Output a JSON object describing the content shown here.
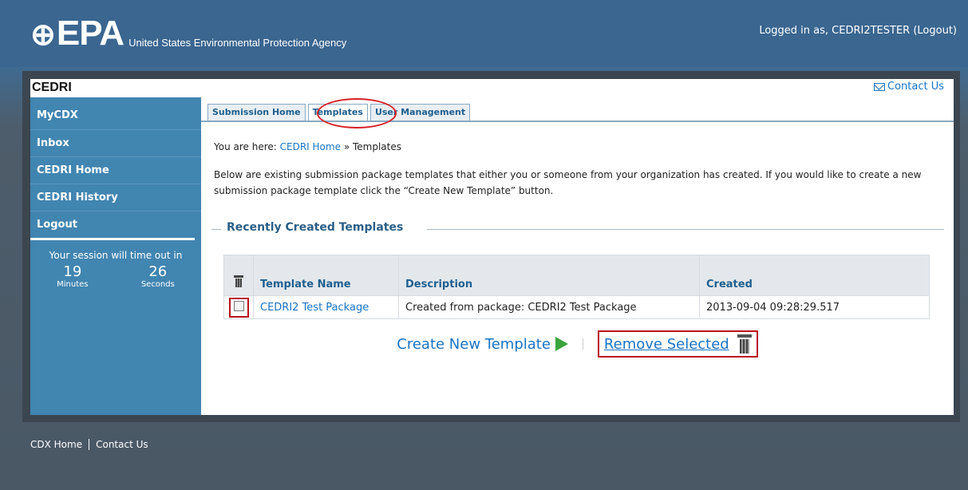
{
  "header": {
    "logo_symbol": "⊕",
    "logo_text": "EPA",
    "agency": "United States Environmental Protection Agency",
    "login_prefix": "Logged in as, CEDRI2TESTER",
    "logout_link": "(Logout)"
  },
  "app": {
    "title": "CEDRI",
    "contact_us": "Contact Us"
  },
  "sidebar": {
    "items": [
      {
        "label": "MyCDX"
      },
      {
        "label": "Inbox"
      },
      {
        "label": "CEDRI Home"
      },
      {
        "label": "CEDRI History"
      },
      {
        "label": "Logout"
      }
    ],
    "session_text": "Your session will time out in",
    "minutes_value": "19",
    "minutes_label": "Minutes",
    "seconds_value": "26",
    "seconds_label": "Seconds"
  },
  "tabs": [
    {
      "label": "Submission Home"
    },
    {
      "label": "Templates"
    },
    {
      "label": "User Management"
    }
  ],
  "breadcrumb": {
    "prefix": "You are here:",
    "home": "CEDRI Home",
    "separator": "»",
    "current": "Templates"
  },
  "description": "Below are existing submission package templates that either you or someone from your organization has created. If you would like to create a new submission package template click the “Create New Template” button.",
  "section_title": "Recently Created Templates",
  "table": {
    "columns": [
      "Template Name",
      "Description",
      "Created"
    ],
    "rows": [
      {
        "name": "CEDRI2 Test Package",
        "description": "Created from package: CEDRI2 Test Package",
        "created": "2013-09-04 09:28:29.517"
      }
    ]
  },
  "actions": {
    "create": "Create New Template",
    "remove": "Remove Selected"
  },
  "footer": {
    "cdx_home": "CDX Home",
    "contact_us": "Contact Us"
  },
  "colors": {
    "header_blue": "#3a6690",
    "sidebar_blue": "#4185b1",
    "link_blue": "#1a74c4",
    "highlight_red": "#b8121a",
    "arrow_green": "#3aa43a"
  }
}
